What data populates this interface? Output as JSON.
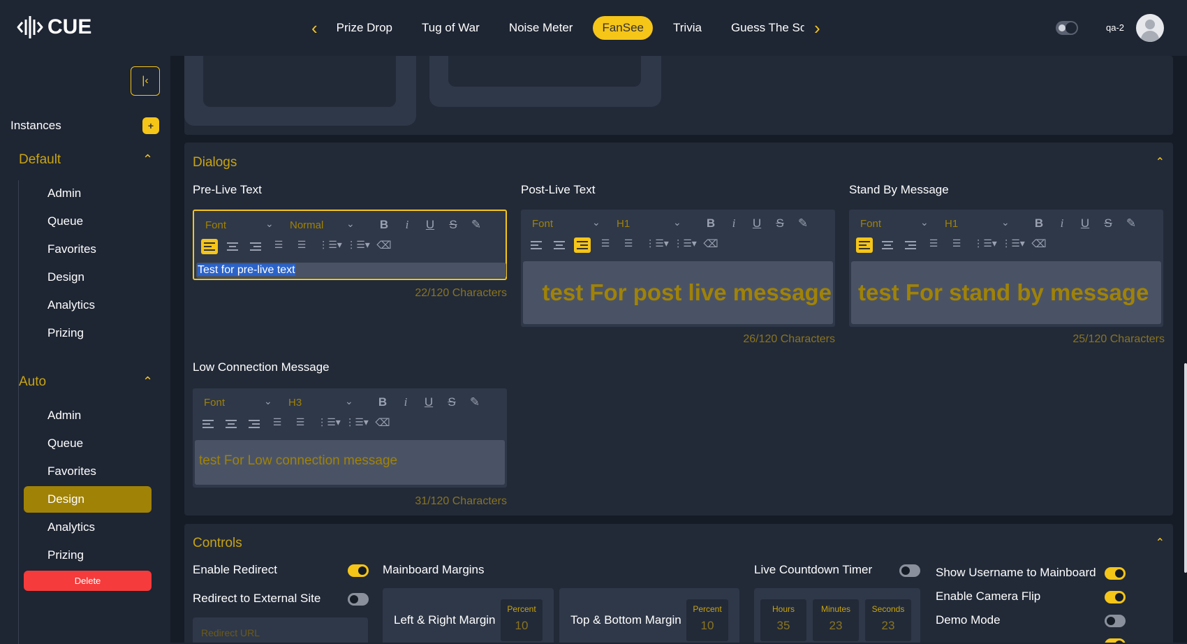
{
  "app": {
    "logo_text": "CUE",
    "username": "qa-2"
  },
  "nav_tabs": [
    "Prize Drop",
    "Tug of War",
    "Noise Meter",
    "FanSee",
    "Trivia",
    "Guess The Sco"
  ],
  "active_tab": "FanSee",
  "sidebar": {
    "instances_label": "Instances",
    "add_label": "+",
    "groups": [
      {
        "title": "Default",
        "items": [
          "Admin",
          "Queue",
          "Favorites",
          "Design",
          "Analytics",
          "Prizing"
        ]
      },
      {
        "title": "Auto",
        "items": [
          "Admin",
          "Queue",
          "Favorites",
          "Design",
          "Analytics",
          "Prizing"
        ],
        "active": "Design"
      }
    ],
    "delete_label": "Delete"
  },
  "dialogs": {
    "title": "Dialogs",
    "editors": [
      {
        "label": "Pre-Live Text",
        "font": "Font",
        "size": "Normal",
        "content": "Test for pre-live text",
        "count": "22/120 Characters"
      },
      {
        "label": "Post-Live Text",
        "font": "Font",
        "size": "H1",
        "content": "test For post live message",
        "count": "26/120 Characters"
      },
      {
        "label": "Stand By Message",
        "font": "Font",
        "size": "H1",
        "content": "test For stand by message",
        "count": "25/120 Characters"
      },
      {
        "label": "Low Connection Message",
        "font": "Font",
        "size": "H3",
        "content": "test For Low connection message",
        "count": "31/120 Characters"
      }
    ]
  },
  "controls": {
    "title": "Controls",
    "enable_redirect": "Enable Redirect",
    "redirect_external": "Redirect to External Site",
    "redirect_url_placeholder": "Redirect URL",
    "mainboard_margins": "Mainboard Margins",
    "lr_margin": "Left & Right Margin",
    "tb_margin": "Top & Bottom Margin",
    "percent_label": "Percent",
    "lr_value": "10",
    "tb_value": "10",
    "live_countdown": "Live Countdown Timer",
    "hours_label": "Hours",
    "minutes_label": "Minutes",
    "seconds_label": "Seconds",
    "hours": "35",
    "minutes": "23",
    "seconds": "23",
    "show_username": "Show Username to Mainboard",
    "camera_flip": "Enable Camera Flip",
    "demo_mode": "Demo Mode",
    "toggles": {
      "enable_redirect": true,
      "redirect_external": false,
      "live_countdown": false,
      "show_username": true,
      "camera_flip": true,
      "demo_mode": false
    }
  }
}
